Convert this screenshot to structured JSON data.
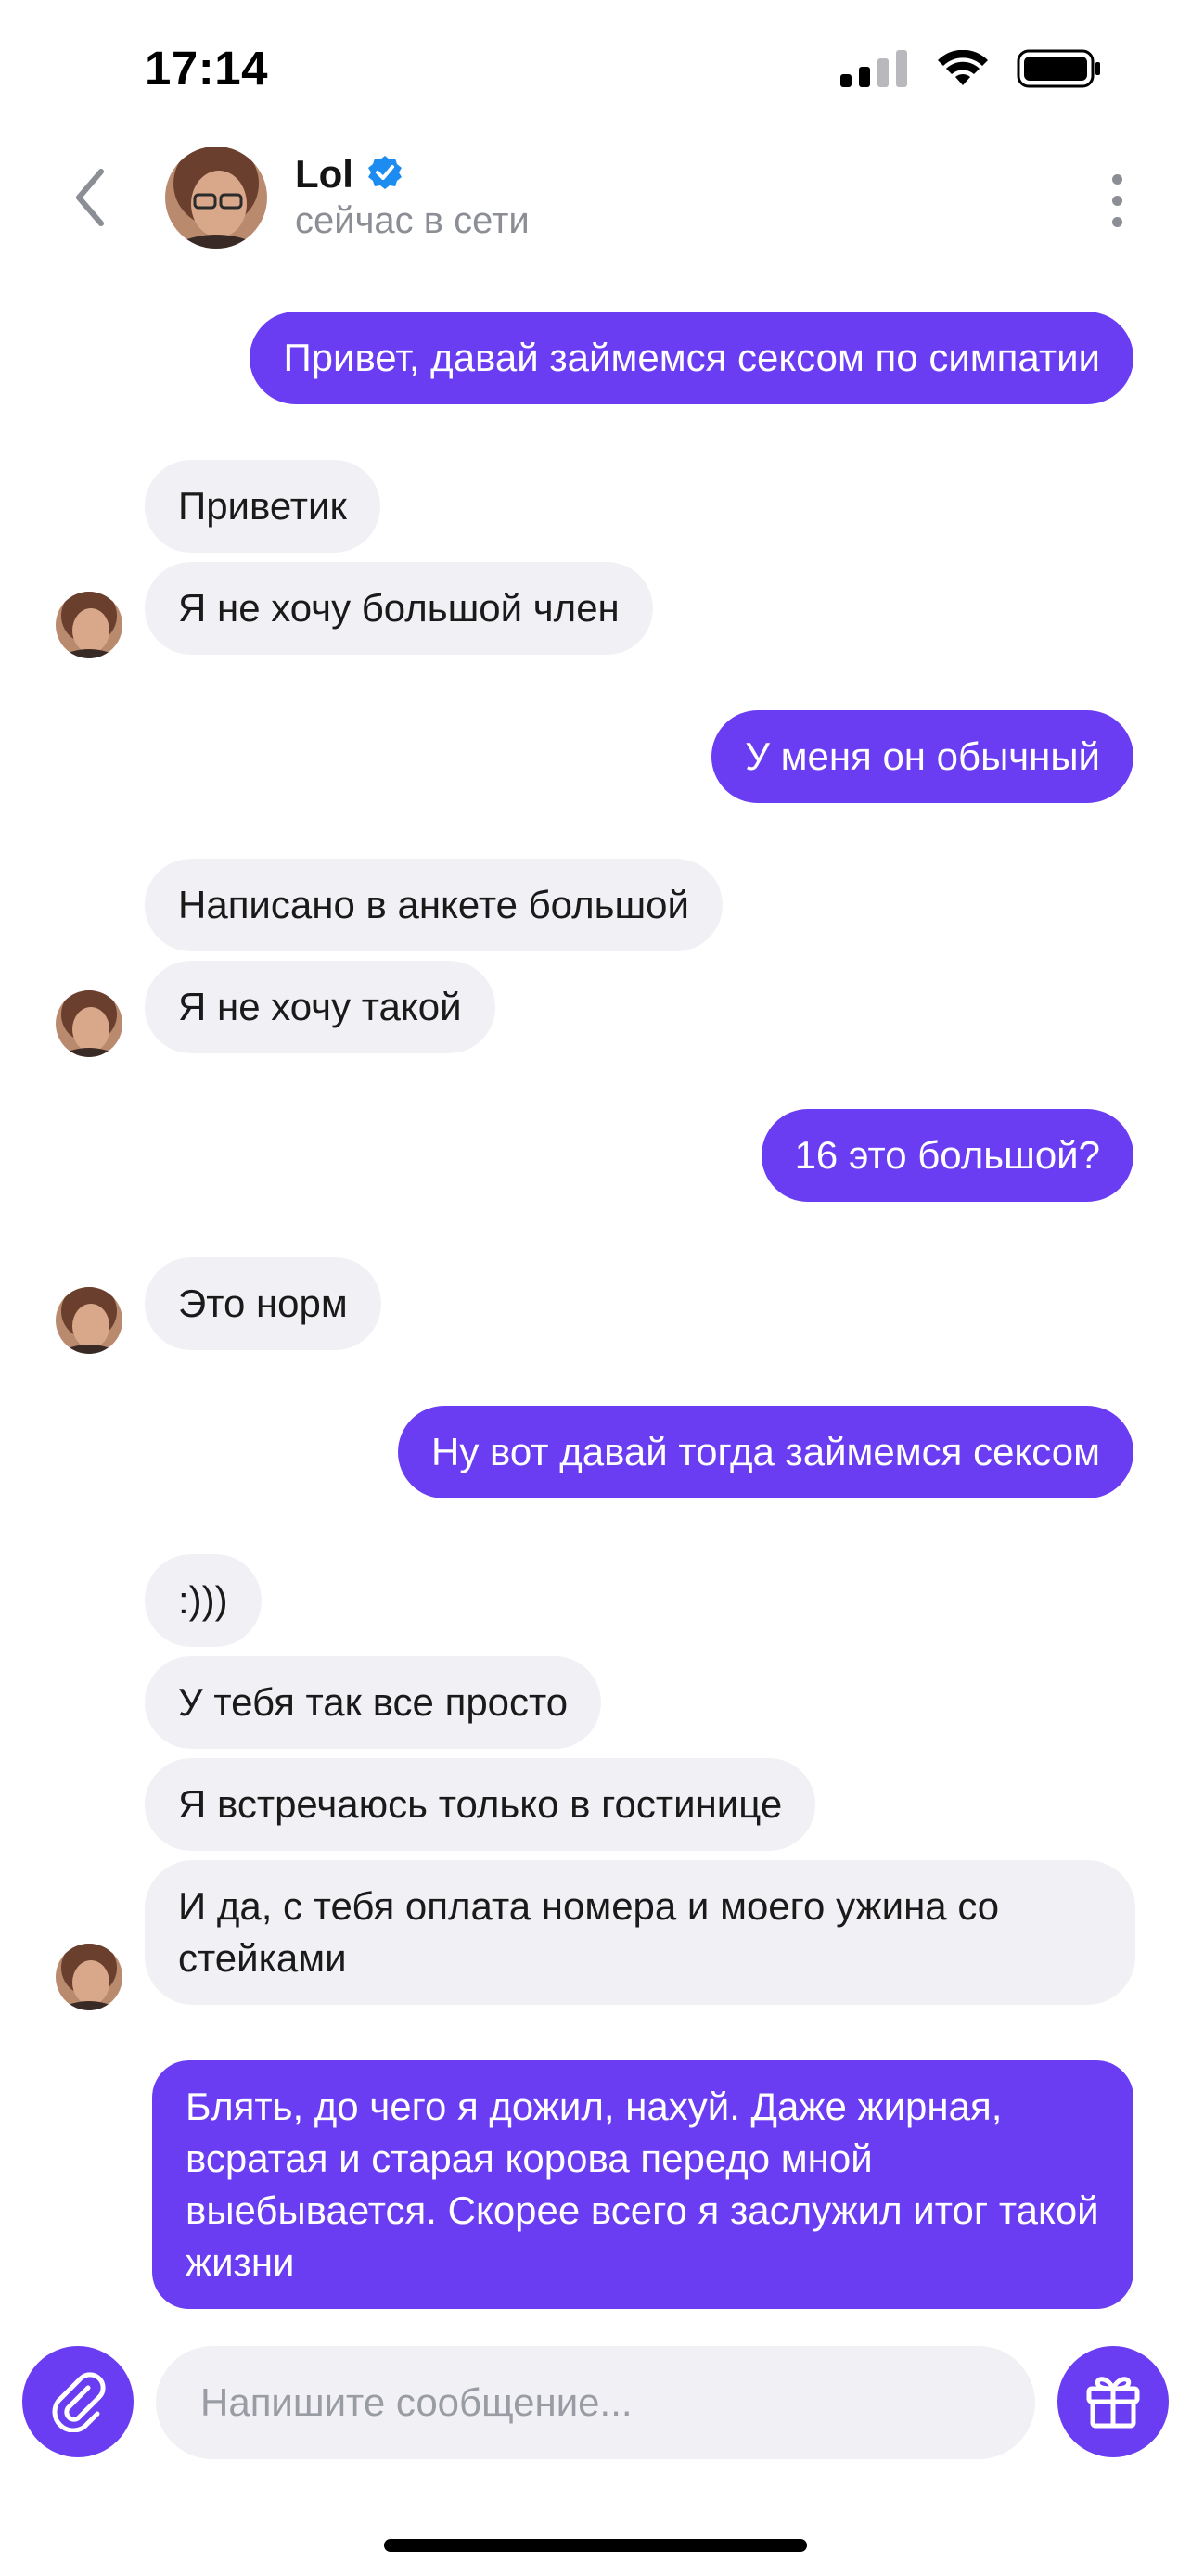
{
  "status_bar": {
    "time": "17:14",
    "icons": [
      "cellular-signal-icon",
      "wifi-icon",
      "battery-icon"
    ]
  },
  "header": {
    "back_icon": "chevron-left-icon",
    "contact_name": "Lol",
    "verified_icon": "verified-badge-icon",
    "contact_status": "сейчас в сети",
    "more_icon": "more-vertical-icon"
  },
  "messages": [
    {
      "direction": "out",
      "text": "Привет, давай займемся сексом по симпатии"
    },
    {
      "direction": "in",
      "text": "Приветик"
    },
    {
      "direction": "in",
      "text": "Я не хочу большой член",
      "avatar": true
    },
    {
      "direction": "out",
      "text": "У меня он обычный"
    },
    {
      "direction": "in",
      "text": "Написано в анкете большой"
    },
    {
      "direction": "in",
      "text": "Я не хочу такой",
      "avatar": true
    },
    {
      "direction": "out",
      "text": "16 это большой?"
    },
    {
      "direction": "in",
      "text": "Это норм",
      "avatar": true
    },
    {
      "direction": "out",
      "text": "Ну вот давай тогда займемся сексом"
    },
    {
      "direction": "in",
      "text": ":)))"
    },
    {
      "direction": "in",
      "text": "У тебя так все просто"
    },
    {
      "direction": "in",
      "text": "Я встречаюсь только в гостинице"
    },
    {
      "direction": "in",
      "text": "И да, с тебя оплата номера и моего ужина со стейками",
      "avatar": true
    },
    {
      "direction": "out",
      "text": "Блять, до чего я дожил, нахуй. Даже жирная, всратая и старая корова передо мной выебывается. Скорее всего я заслужил итог такой жизни"
    }
  ],
  "composer": {
    "attach_icon": "paperclip-icon",
    "placeholder": "Напишите сообщение...",
    "gift_icon": "gift-icon"
  },
  "colors": {
    "accent": "#6a3cf2",
    "incoming_bubble": "#f1f1f5",
    "status_gray": "#8c8e96",
    "verified_blue": "#1d8cf0"
  }
}
